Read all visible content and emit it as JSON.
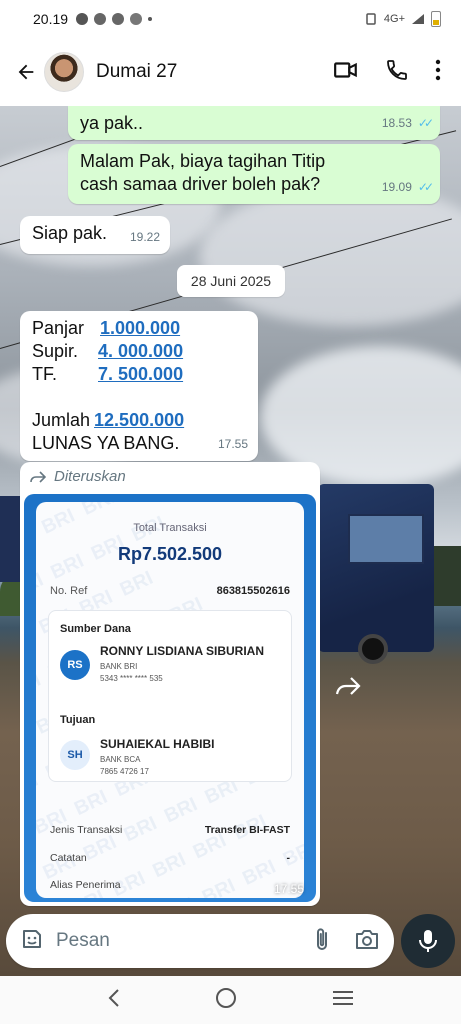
{
  "status_bar": {
    "time": "20.19",
    "network": "4G+"
  },
  "header": {
    "contact_name": "Dumai 27"
  },
  "messages": {
    "m1": {
      "text": "ya pak..",
      "time": "18.53"
    },
    "m2": {
      "text": "Malam Pak, biaya tagihan Titip cash samaa driver boleh pak?",
      "time": "19.09"
    },
    "m3": {
      "text": "Siap pak.",
      "time": "19.22"
    },
    "date_separator": "28 Juni 2025",
    "m4": {
      "rows": [
        {
          "label": "Panjar",
          "value": "1.000.000"
        },
        {
          "label": "Supir.",
          "value": "4. 000.000"
        },
        {
          "label": "TF.",
          "value": "7. 500.000"
        }
      ],
      "total_label": "Jumlah",
      "total_value": "12.500.000",
      "note": "LUNAS YA BANG.",
      "time": "17.55"
    },
    "forwarded": {
      "label": "Diteruskan",
      "time": "17.55",
      "receipt": {
        "total_label": "Total Transaksi",
        "total_amount": "Rp7.502.500",
        "ref_label": "No. Ref",
        "ref_value": "863815502616",
        "source_label": "Sumber Dana",
        "source_initials": "RS",
        "source_name": "RONNY LISDIANA SIBURIAN",
        "source_bank": "BANK BRI",
        "source_account": "5343 **** **** 535",
        "dest_label": "Tujuan",
        "dest_initials": "SH",
        "dest_name": "SUHAIEKAL HABIBI",
        "dest_bank": "BANK BCA",
        "dest_account": "7865 4726 17",
        "rows": [
          {
            "label": "Jenis Transaksi",
            "value": "Transfer BI-FAST"
          },
          {
            "label": "Catatan",
            "value": "-"
          },
          {
            "label": "Alias Penerima",
            "value": ""
          }
        ],
        "watermark": "BRI"
      }
    }
  },
  "composer": {
    "placeholder": "Pesan"
  },
  "colors": {
    "outgoing_bubble": "#d9fdd3",
    "incoming_bubble": "#ffffff",
    "read_ticks": "#53bdeb",
    "link_value": "#1f6dbf",
    "bri_blue": "#1c72c7",
    "mic_button": "#1f2c34"
  },
  "icons": [
    "back-arrow-icon",
    "video-call-icon",
    "phone-call-icon",
    "more-vert-icon",
    "forward-icon",
    "sticker-icon",
    "attach-icon",
    "camera-icon",
    "mic-icon",
    "nav-back-icon",
    "nav-home-icon",
    "nav-recents-icon"
  ]
}
